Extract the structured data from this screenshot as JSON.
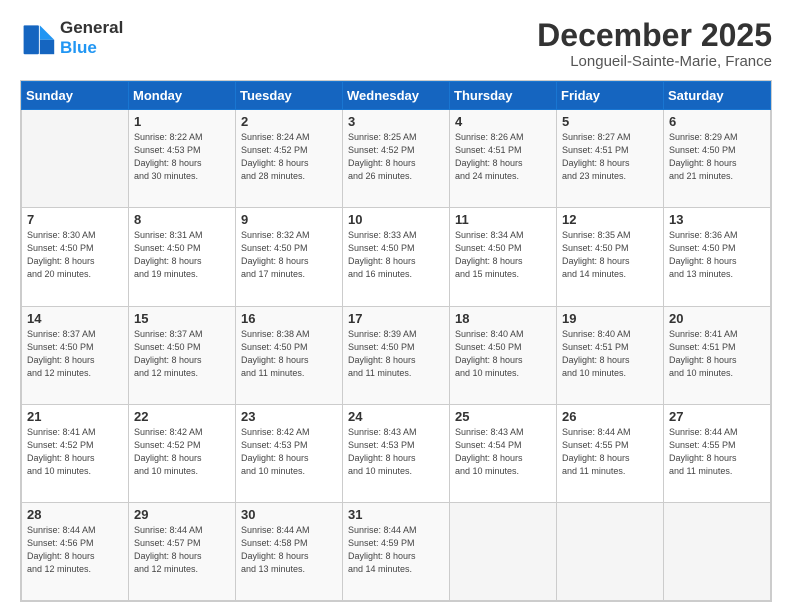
{
  "header": {
    "logo": {
      "line1": "General",
      "line2": "Blue"
    },
    "month": "December 2025",
    "location": "Longueil-Sainte-Marie, France"
  },
  "weekdays": [
    "Sunday",
    "Monday",
    "Tuesday",
    "Wednesday",
    "Thursday",
    "Friday",
    "Saturday"
  ],
  "weeks": [
    [
      {
        "day": "",
        "info": ""
      },
      {
        "day": "1",
        "info": "Sunrise: 8:22 AM\nSunset: 4:53 PM\nDaylight: 8 hours\nand 30 minutes."
      },
      {
        "day": "2",
        "info": "Sunrise: 8:24 AM\nSunset: 4:52 PM\nDaylight: 8 hours\nand 28 minutes."
      },
      {
        "day": "3",
        "info": "Sunrise: 8:25 AM\nSunset: 4:52 PM\nDaylight: 8 hours\nand 26 minutes."
      },
      {
        "day": "4",
        "info": "Sunrise: 8:26 AM\nSunset: 4:51 PM\nDaylight: 8 hours\nand 24 minutes."
      },
      {
        "day": "5",
        "info": "Sunrise: 8:27 AM\nSunset: 4:51 PM\nDaylight: 8 hours\nand 23 minutes."
      },
      {
        "day": "6",
        "info": "Sunrise: 8:29 AM\nSunset: 4:50 PM\nDaylight: 8 hours\nand 21 minutes."
      }
    ],
    [
      {
        "day": "7",
        "info": "Sunrise: 8:30 AM\nSunset: 4:50 PM\nDaylight: 8 hours\nand 20 minutes."
      },
      {
        "day": "8",
        "info": "Sunrise: 8:31 AM\nSunset: 4:50 PM\nDaylight: 8 hours\nand 19 minutes."
      },
      {
        "day": "9",
        "info": "Sunrise: 8:32 AM\nSunset: 4:50 PM\nDaylight: 8 hours\nand 17 minutes."
      },
      {
        "day": "10",
        "info": "Sunrise: 8:33 AM\nSunset: 4:50 PM\nDaylight: 8 hours\nand 16 minutes."
      },
      {
        "day": "11",
        "info": "Sunrise: 8:34 AM\nSunset: 4:50 PM\nDaylight: 8 hours\nand 15 minutes."
      },
      {
        "day": "12",
        "info": "Sunrise: 8:35 AM\nSunset: 4:50 PM\nDaylight: 8 hours\nand 14 minutes."
      },
      {
        "day": "13",
        "info": "Sunrise: 8:36 AM\nSunset: 4:50 PM\nDaylight: 8 hours\nand 13 minutes."
      }
    ],
    [
      {
        "day": "14",
        "info": "Sunrise: 8:37 AM\nSunset: 4:50 PM\nDaylight: 8 hours\nand 12 minutes."
      },
      {
        "day": "15",
        "info": "Sunrise: 8:37 AM\nSunset: 4:50 PM\nDaylight: 8 hours\nand 12 minutes."
      },
      {
        "day": "16",
        "info": "Sunrise: 8:38 AM\nSunset: 4:50 PM\nDaylight: 8 hours\nand 11 minutes."
      },
      {
        "day": "17",
        "info": "Sunrise: 8:39 AM\nSunset: 4:50 PM\nDaylight: 8 hours\nand 11 minutes."
      },
      {
        "day": "18",
        "info": "Sunrise: 8:40 AM\nSunset: 4:50 PM\nDaylight: 8 hours\nand 10 minutes."
      },
      {
        "day": "19",
        "info": "Sunrise: 8:40 AM\nSunset: 4:51 PM\nDaylight: 8 hours\nand 10 minutes."
      },
      {
        "day": "20",
        "info": "Sunrise: 8:41 AM\nSunset: 4:51 PM\nDaylight: 8 hours\nand 10 minutes."
      }
    ],
    [
      {
        "day": "21",
        "info": "Sunrise: 8:41 AM\nSunset: 4:52 PM\nDaylight: 8 hours\nand 10 minutes."
      },
      {
        "day": "22",
        "info": "Sunrise: 8:42 AM\nSunset: 4:52 PM\nDaylight: 8 hours\nand 10 minutes."
      },
      {
        "day": "23",
        "info": "Sunrise: 8:42 AM\nSunset: 4:53 PM\nDaylight: 8 hours\nand 10 minutes."
      },
      {
        "day": "24",
        "info": "Sunrise: 8:43 AM\nSunset: 4:53 PM\nDaylight: 8 hours\nand 10 minutes."
      },
      {
        "day": "25",
        "info": "Sunrise: 8:43 AM\nSunset: 4:54 PM\nDaylight: 8 hours\nand 10 minutes."
      },
      {
        "day": "26",
        "info": "Sunrise: 8:44 AM\nSunset: 4:55 PM\nDaylight: 8 hours\nand 11 minutes."
      },
      {
        "day": "27",
        "info": "Sunrise: 8:44 AM\nSunset: 4:55 PM\nDaylight: 8 hours\nand 11 minutes."
      }
    ],
    [
      {
        "day": "28",
        "info": "Sunrise: 8:44 AM\nSunset: 4:56 PM\nDaylight: 8 hours\nand 12 minutes."
      },
      {
        "day": "29",
        "info": "Sunrise: 8:44 AM\nSunset: 4:57 PM\nDaylight: 8 hours\nand 12 minutes."
      },
      {
        "day": "30",
        "info": "Sunrise: 8:44 AM\nSunset: 4:58 PM\nDaylight: 8 hours\nand 13 minutes."
      },
      {
        "day": "31",
        "info": "Sunrise: 8:44 AM\nSunset: 4:59 PM\nDaylight: 8 hours\nand 14 minutes."
      },
      {
        "day": "",
        "info": ""
      },
      {
        "day": "",
        "info": ""
      },
      {
        "day": "",
        "info": ""
      }
    ]
  ]
}
